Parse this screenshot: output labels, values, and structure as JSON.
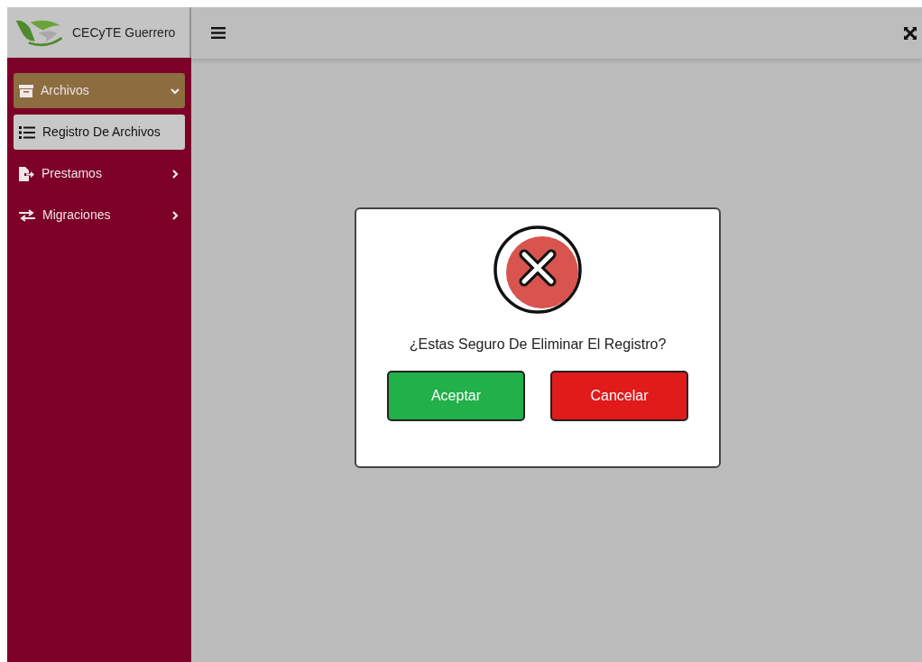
{
  "sidebar": {
    "brand": "CECyTE Guerrero",
    "items": [
      {
        "label": "Archivos",
        "kind": "archive",
        "expanded": true,
        "children": [
          {
            "label": "Registro De Archivos",
            "kind": "list",
            "selected": true
          }
        ]
      },
      {
        "label": "Prestamos",
        "kind": "file-export",
        "expanded": false
      },
      {
        "label": "Migraciones",
        "kind": "exchange",
        "expanded": false
      }
    ]
  },
  "dialog": {
    "message": "¿Estas Seguro De Eliminar El Registro?",
    "buttons": [
      {
        "label": "Aceptar",
        "kind": "confirm"
      },
      {
        "label": "Cancelar",
        "kind": "cancel"
      }
    ]
  }
}
